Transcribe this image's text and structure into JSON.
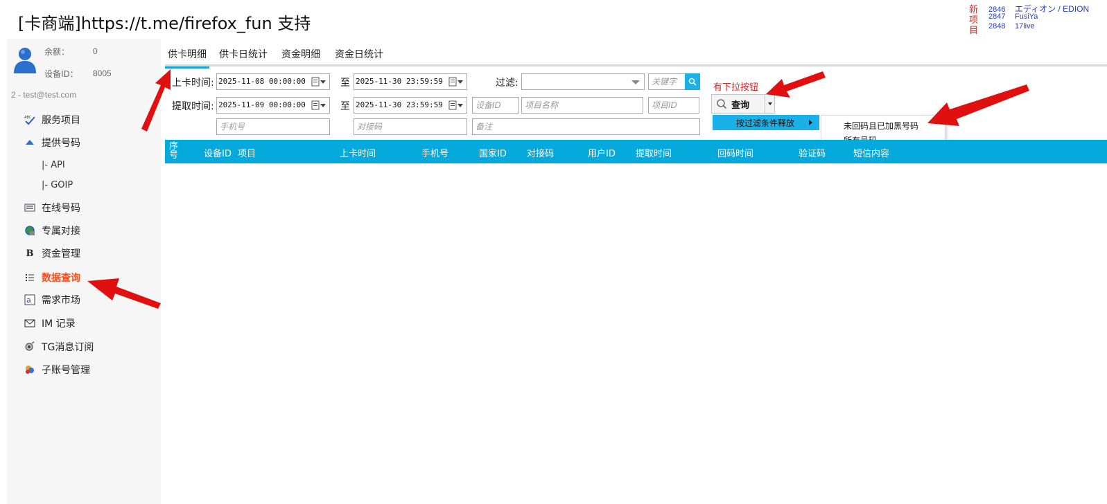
{
  "title": {
    "prefix": "[",
    "brand": "卡商端",
    "middle": "]https://t.me/firefox_fun ",
    "suffix": "支持"
  },
  "news": {
    "label": "新项目",
    "items": [
      {
        "id": "2846",
        "name": "エディオン / EDION"
      },
      {
        "id": "2847",
        "name": "FusiYa"
      },
      {
        "id": "2848",
        "name": "17live"
      }
    ]
  },
  "sidebar": {
    "balance_label": "余额：",
    "balance_value": "0",
    "device_label": "设备ID：",
    "device_value": "8005",
    "user_line": "2 - test@test.com",
    "items": [
      {
        "label": "服务项目",
        "icon": "abc-check-icon"
      },
      {
        "label": "提供号码",
        "icon": "up-arrow-icon"
      },
      {
        "label": "|-  API",
        "icon": ""
      },
      {
        "label": "|-  GOIP",
        "icon": ""
      },
      {
        "label": "在线号码",
        "icon": "id-card-icon"
      },
      {
        "label": "专属对接",
        "icon": "globe-icon"
      },
      {
        "label": "资金管理",
        "icon": "bold-b-icon"
      },
      {
        "label": "数据查询",
        "icon": "list-icon"
      },
      {
        "label": "需求市场",
        "icon": "at-icon"
      },
      {
        "label": "IM 记录",
        "icon": "envelope-icon"
      },
      {
        "label": "TG消息订阅",
        "icon": "satellite-icon"
      },
      {
        "label": "子账号管理",
        "icon": "users-icon"
      }
    ]
  },
  "tabs": [
    "供卡明细",
    "供卡日统计",
    "资金明细",
    "资金日统计"
  ],
  "form": {
    "card_time_label": "上卡时间:",
    "fetch_time_label": "提取时间:",
    "to_label": "至",
    "card_start": "2025-11-08 00:00:00",
    "card_end": "2025-11-30 23:59:59",
    "fetch_start": "2025-11-09 00:00:00",
    "fetch_end": "2025-11-30 23:59:59",
    "filter_label": "过滤:",
    "keyword_placeholder": "关键字",
    "device_id_placeholder": "设备ID",
    "project_name_placeholder": "项目名称",
    "project_id_placeholder": "项目ID",
    "phone_placeholder": "手机号",
    "pair_code_placeholder": "对接码",
    "remark_placeholder": "备注",
    "hint": "有下拉按钮",
    "query_label": "查询",
    "menu_release": "按过滤条件释放",
    "submenu": [
      "未回码且已加黑号码",
      "所有号码"
    ]
  },
  "table": {
    "headers": [
      "序号",
      "设备ID",
      "项目",
      "上卡时间",
      "手机号",
      "国家ID",
      "对接码",
      "用户ID",
      "提取时间",
      "回码时间",
      "验证码",
      "短信内容"
    ]
  },
  "colors": {
    "accent": "#06a9dc",
    "active_nav": "#ff4a1a",
    "annotation_arrow": "#e01010"
  }
}
